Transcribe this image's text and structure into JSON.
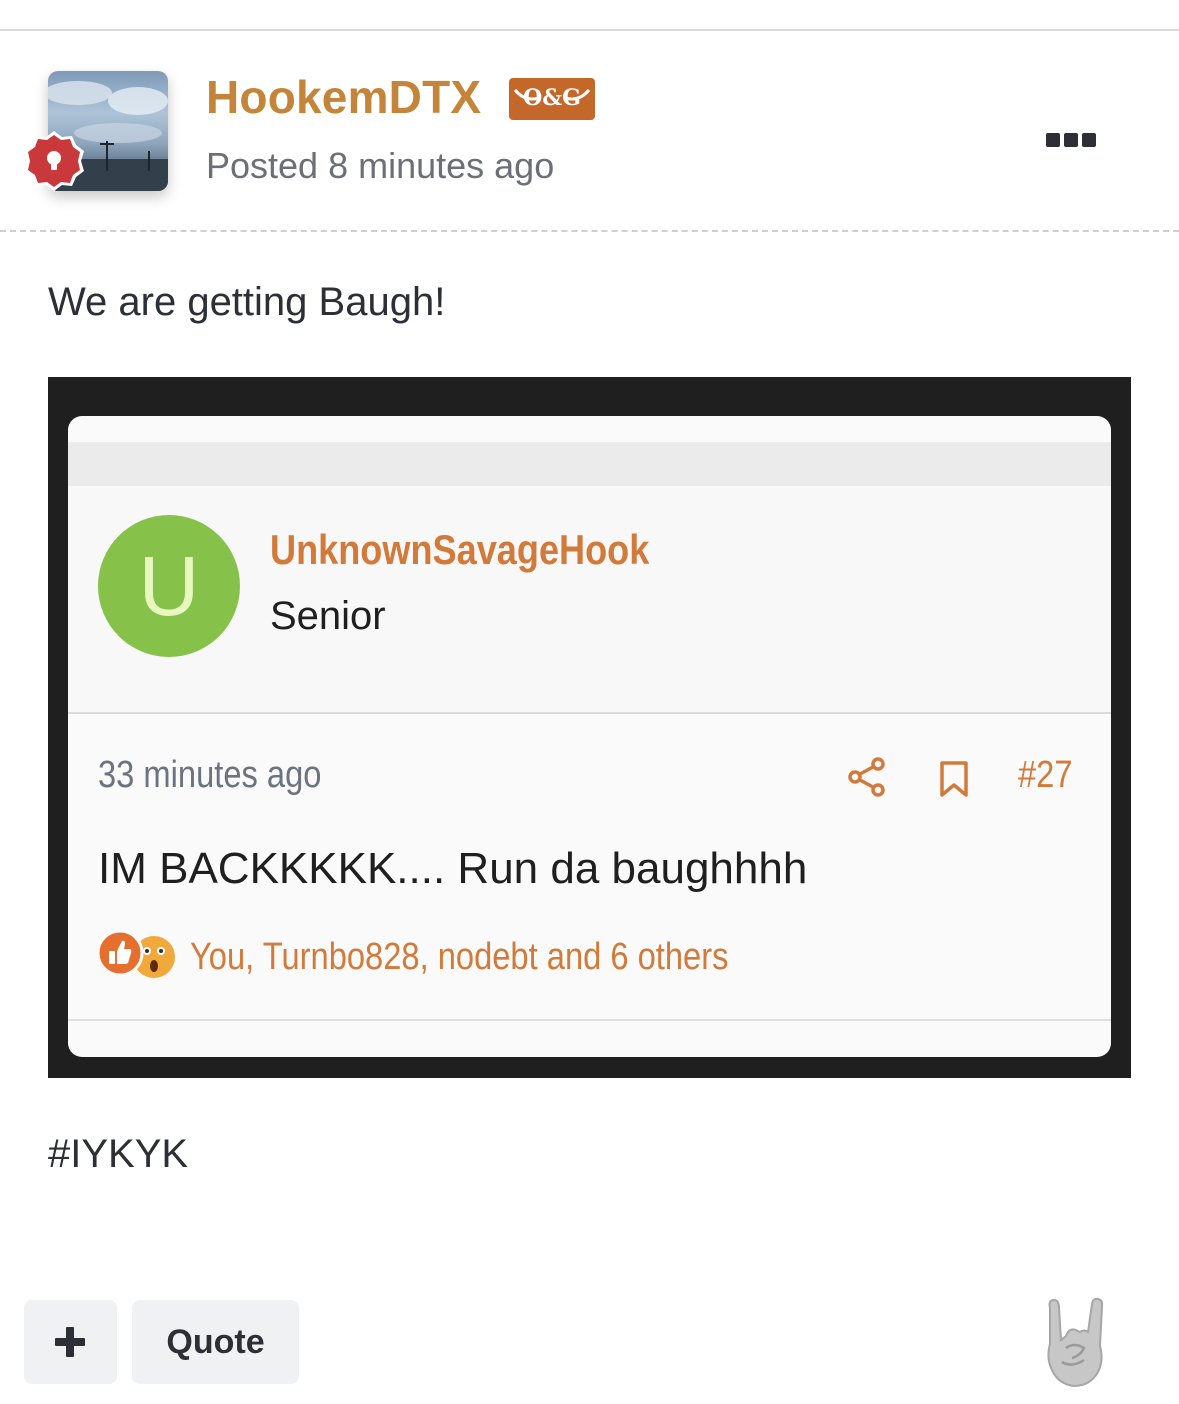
{
  "post": {
    "author": "HookemDTX",
    "badge_label": "O&G",
    "posted": "Posted 8 minutes ago",
    "text": "We are getting Baugh!",
    "hashtag": "#IYKYK"
  },
  "embed": {
    "avatar_letter": "U",
    "username": "UnknownSavageHook",
    "rank": "Senior",
    "time": "33 minutes ago",
    "post_number": "#27",
    "body": "IM BACKKKKK.... Run da baughhhh",
    "reactions": "You, Turnbo828, nodebt and 6 others"
  },
  "actions": {
    "plus_symbol": "+",
    "quote_label": "Quote"
  },
  "icons": {
    "more": "more-options-icon",
    "rank": "lightbulb-icon",
    "share": "share-icon",
    "bookmark": "bookmark-icon",
    "like": "thumbs-up-icon",
    "wow": "wow-face-icon",
    "reaction": "rock-on-hand-icon"
  },
  "colors": {
    "accent": "#c4843a",
    "badge": "#c4682a",
    "embed_accent": "#d27a3a",
    "avatar_green": "#86c24a"
  }
}
